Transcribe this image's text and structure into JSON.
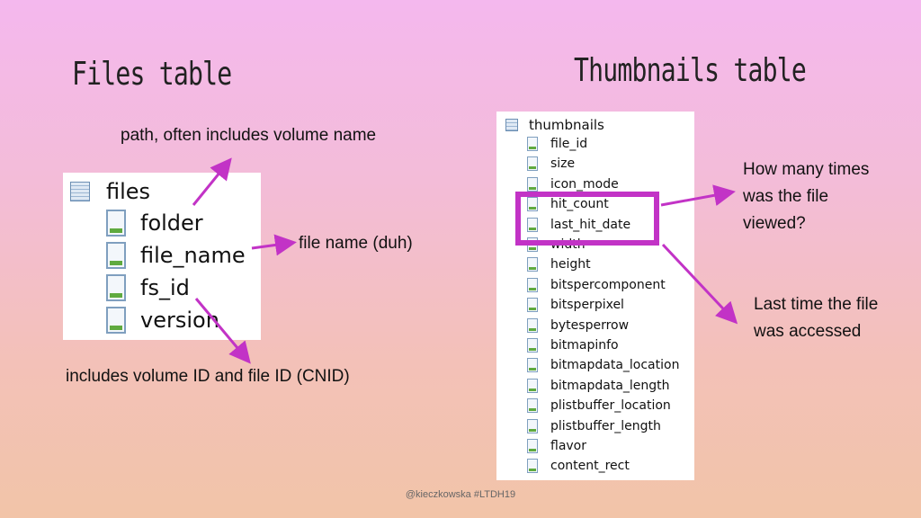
{
  "titles": {
    "files": "Files table",
    "thumbnails": "Thumbnails table"
  },
  "files_table": {
    "name": "files",
    "columns": [
      "folder",
      "file_name",
      "fs_id",
      "version"
    ]
  },
  "thumbnails_table": {
    "name": "thumbnails",
    "columns": [
      "file_id",
      "size",
      "icon_mode",
      "hit_count",
      "last_hit_date",
      "width",
      "height",
      "bitspercomponent",
      "bitsperpixel",
      "bytesperrow",
      "bitmapinfo",
      "bitmapdata_location",
      "bitmapdata_length",
      "plistbuffer_location",
      "plistbuffer_length",
      "flavor",
      "content_rect"
    ]
  },
  "annotations": {
    "path": "path, often includes volume name",
    "file_name": "file name (duh)",
    "fs_id": "includes volume ID and file ID (CNID)",
    "hit_count_line1": "How many times",
    "hit_count_line2": "was the file",
    "hit_count_line3": "viewed?",
    "last_hit_line1": "Last time the file",
    "last_hit_line2": "was accessed"
  },
  "footer": "@kieczkowska #LTDH19",
  "colors": {
    "accent": "#c233c6",
    "bg_top": "#f4b8ee",
    "bg_bottom": "#f2c4a8"
  }
}
